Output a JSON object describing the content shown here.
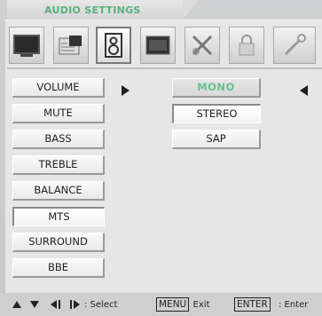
{
  "header": {
    "title": "AUDIO SETTINGS"
  },
  "toolbar": {
    "icons": [
      {
        "name": "tv-picture-icon"
      },
      {
        "name": "pip-icon"
      },
      {
        "name": "speaker-icon"
      },
      {
        "name": "screen-size-icon"
      },
      {
        "name": "tools-icon"
      },
      {
        "name": "lock-icon"
      },
      {
        "name": "wrench-icon"
      }
    ],
    "active_index": 2
  },
  "menu": {
    "items": [
      {
        "label": "VOLUME"
      },
      {
        "label": "MUTE"
      },
      {
        "label": "BASS"
      },
      {
        "label": "TREBLE"
      },
      {
        "label": "BALANCE"
      },
      {
        "label": "MTS"
      },
      {
        "label": "SURROUND"
      },
      {
        "label": "BBE"
      }
    ],
    "selected_label": "MTS"
  },
  "options": {
    "items": [
      {
        "label": "MONO"
      },
      {
        "label": "STEREO"
      },
      {
        "label": "SAP"
      }
    ],
    "highlighted": "MONO",
    "selected": "STEREO"
  },
  "footer": {
    "select_hint": ": Select",
    "menu_key": "MENU",
    "menu_hint": ": Exit",
    "enter_key": "ENTER",
    "enter_hint": ": Enter"
  },
  "colors": {
    "title": "#53b37b",
    "highlight_text": "#66c08c",
    "background": "#e6e6e6"
  }
}
